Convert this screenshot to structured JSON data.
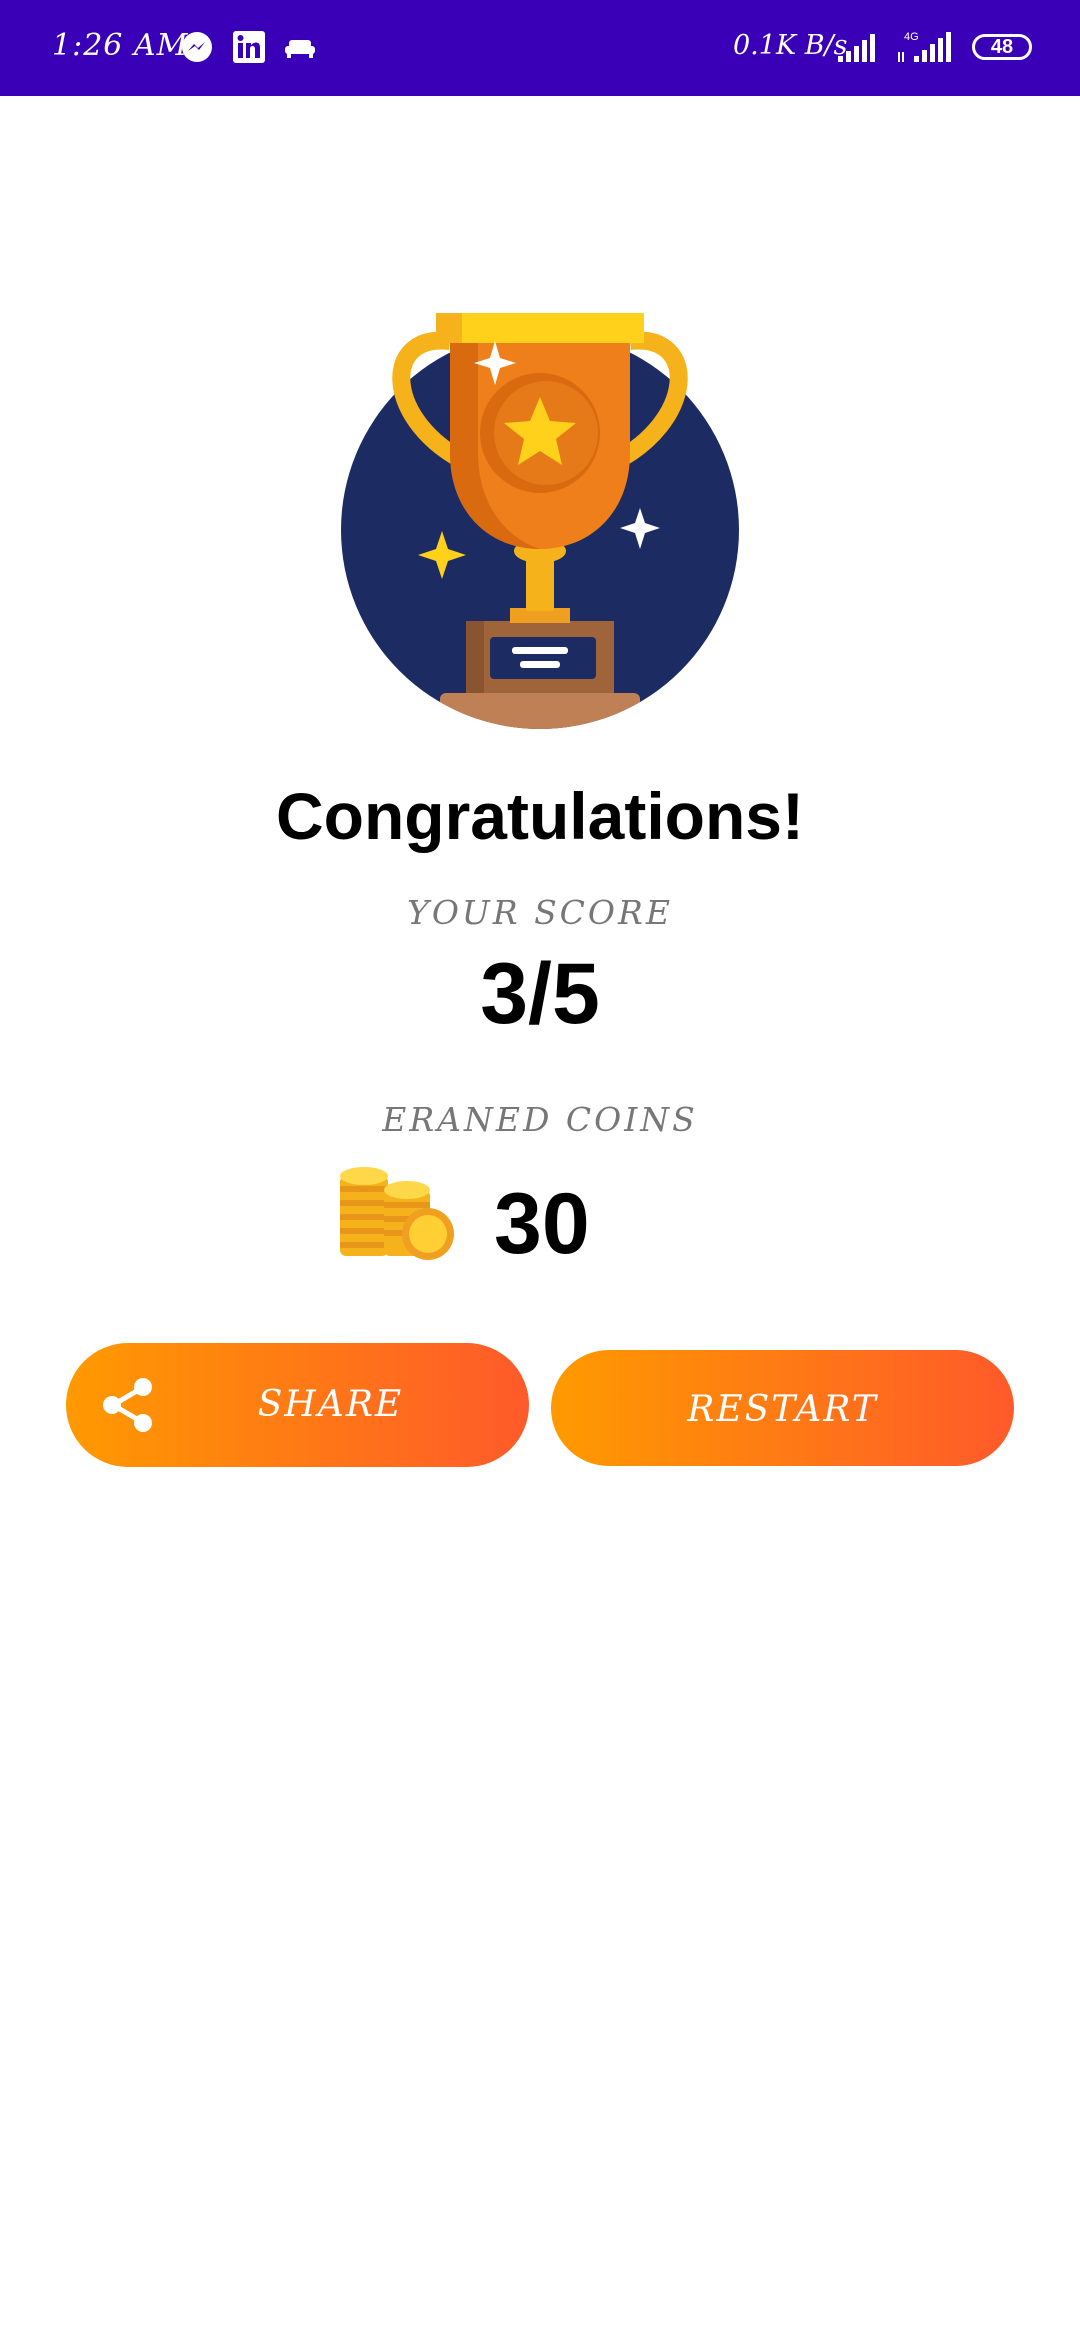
{
  "status_bar": {
    "time": "1:26  AM",
    "net_speed": "0.1K B/s",
    "network_type": "4G",
    "battery": "48",
    "background_color": "#3a00b8",
    "icons": [
      "messenger-icon",
      "linkedin-icon",
      "sofa-icon",
      "signal-icon",
      "signal-4g-icon",
      "battery-icon"
    ]
  },
  "result": {
    "title": "Congratulations!",
    "score_label": "YOUR SCORE",
    "score_value": "3/5",
    "coins_label": "ERANED COINS",
    "coins_value": "30"
  },
  "buttons": {
    "share_label": "SHARE",
    "restart_label": "RESTART",
    "gradient_start": "#ff9a00",
    "gradient_end": "#ff5a2a"
  }
}
